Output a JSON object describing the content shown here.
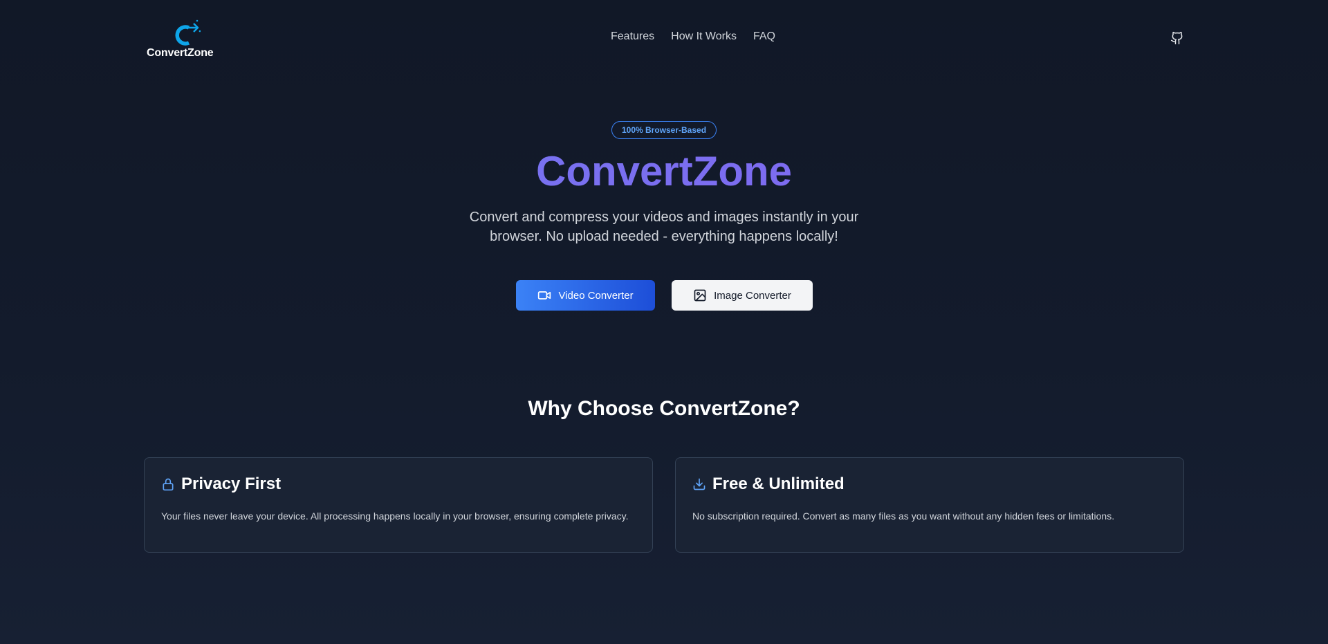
{
  "header": {
    "logo_text": "ConvertZone",
    "nav": [
      {
        "label": "Features"
      },
      {
        "label": "How It Works"
      },
      {
        "label": "FAQ"
      }
    ],
    "github_icon": "github-icon"
  },
  "hero": {
    "badge": "100% Browser-Based",
    "title": "ConvertZone",
    "subtitle": "Convert and compress your videos and images instantly in your browser. No upload needed - everything happens locally!",
    "buttons": {
      "video": {
        "label": "Video Converter",
        "icon": "video-camera-icon"
      },
      "image": {
        "label": "Image Converter",
        "icon": "image-icon"
      }
    }
  },
  "features": {
    "title": "Why Choose ConvertZone?",
    "cards": [
      {
        "icon": "lock-icon",
        "title": "Privacy First",
        "description": "Your files never leave your device. All processing happens locally in your browser, ensuring complete privacy."
      },
      {
        "icon": "download-icon",
        "title": "Free & Unlimited",
        "description": "No subscription required. Convert as many files as you want without any hidden fees or limitations."
      }
    ]
  },
  "colors": {
    "background": "#111827",
    "accent_blue": "#3b82f6",
    "title_gradient_start": "#6f7cf2",
    "title_gradient_end": "#8b5cf6",
    "logo_blue": "#0ea5e9"
  }
}
